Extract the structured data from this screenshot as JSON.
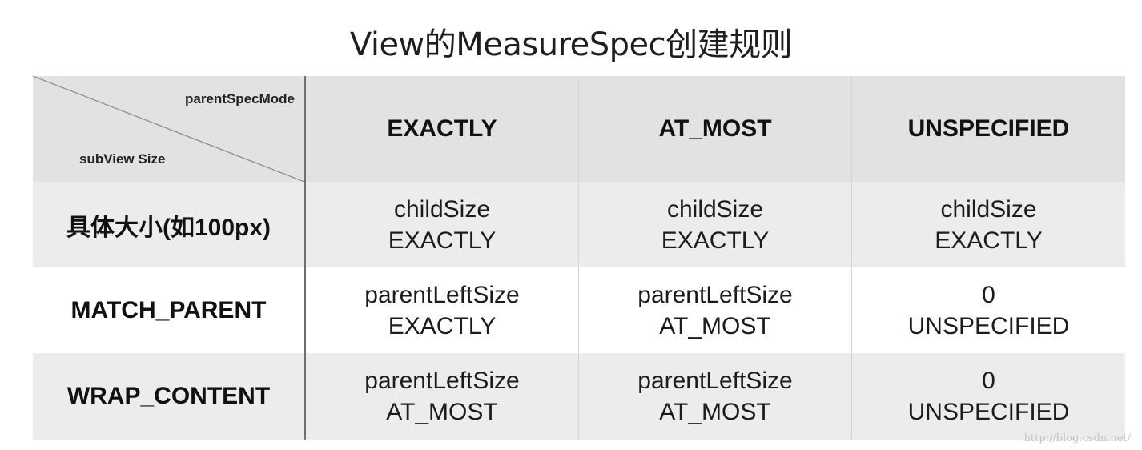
{
  "title": "View的MeasureSpec创建规则",
  "table": {
    "corner": {
      "column_axis_label": "parentSpecMode",
      "row_axis_label": "subView Size"
    },
    "columns": [
      "EXACTLY",
      "AT_MOST",
      "UNSPECIFIED"
    ],
    "rows": [
      {
        "label": "具体大小(如100px)",
        "cells": [
          {
            "size": "childSize",
            "mode": "EXACTLY"
          },
          {
            "size": "childSize",
            "mode": "EXACTLY"
          },
          {
            "size": "childSize",
            "mode": "EXACTLY"
          }
        ]
      },
      {
        "label": "MATCH_PARENT",
        "cells": [
          {
            "size": "parentLeftSize",
            "mode": "EXACTLY"
          },
          {
            "size": "parentLeftSize",
            "mode": "AT_MOST"
          },
          {
            "size": "0",
            "mode": "UNSPECIFIED"
          }
        ]
      },
      {
        "label": "WRAP_CONTENT",
        "cells": [
          {
            "size": "parentLeftSize",
            "mode": "AT_MOST"
          },
          {
            "size": "parentLeftSize",
            "mode": "AT_MOST"
          },
          {
            "size": "0",
            "mode": "UNSPECIFIED"
          }
        ]
      }
    ]
  },
  "watermark": "http://blog.csdn.net/"
}
